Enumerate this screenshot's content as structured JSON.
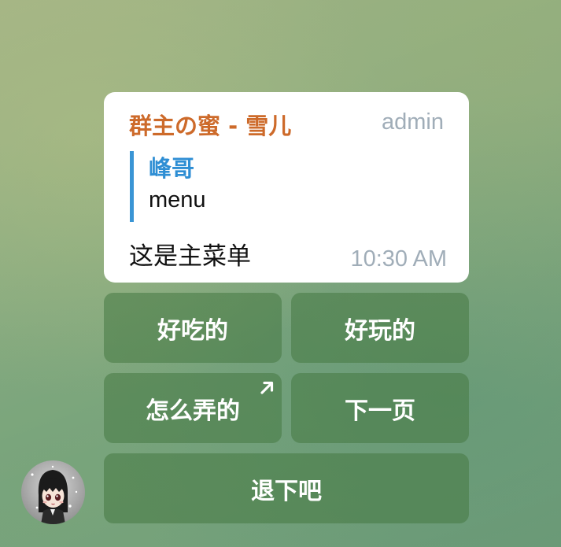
{
  "message": {
    "sender": "群主の蜜 - 雪儿",
    "role": "admin",
    "reply": {
      "name": "峰哥",
      "text": "menu"
    },
    "text": "这是主菜单",
    "time": "10:30 AM"
  },
  "keyboard": {
    "rows": [
      [
        {
          "label": "好吃的"
        },
        {
          "label": "好玩的"
        }
      ],
      [
        {
          "label": "怎么弄的",
          "icon": "arrow-up-right-icon"
        },
        {
          "label": "下一页"
        }
      ],
      [
        {
          "label": "退下吧"
        }
      ]
    ]
  },
  "avatar": {
    "icon": "user-avatar"
  },
  "colors": {
    "sender": "#cd6a2a",
    "reply_accent": "#3a95d5",
    "meta": "#a0adb8",
    "button_bg": "rgba(70,120,65,0.55)"
  }
}
